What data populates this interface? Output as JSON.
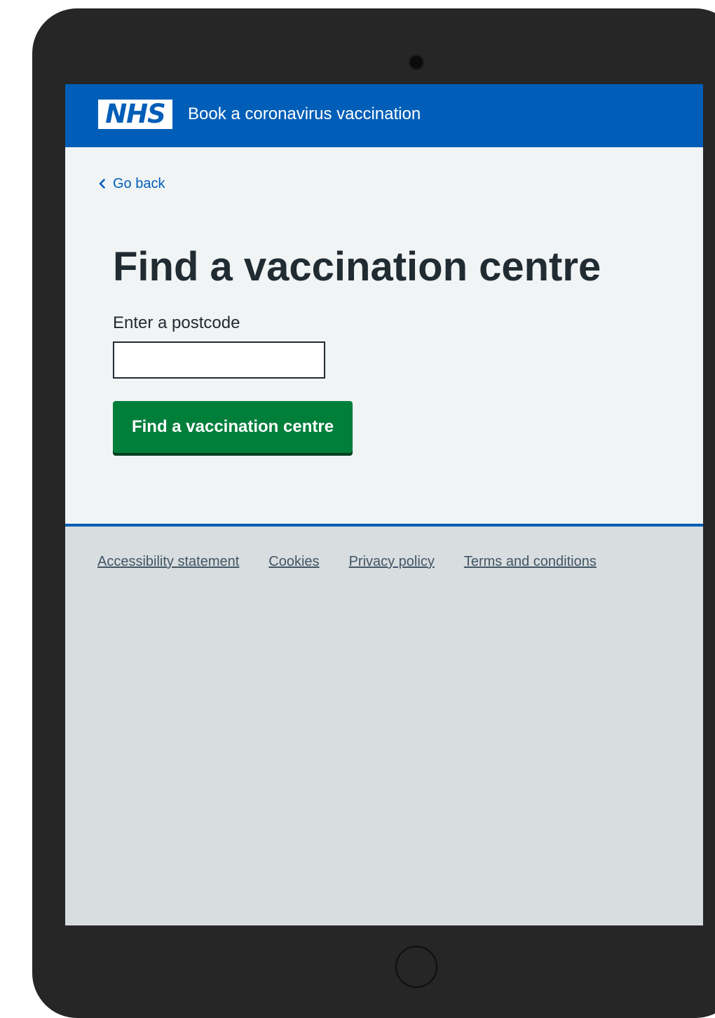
{
  "header": {
    "logo_text": "NHS",
    "service_name": "Book a coronavirus vaccination"
  },
  "nav": {
    "back_label": "Go back",
    "back_icon": "chevron-left-icon"
  },
  "main": {
    "title": "Find a vaccination centre",
    "postcode_label": "Enter a postcode",
    "postcode_value": "",
    "submit_label": "Find a vaccination centre"
  },
  "footer": {
    "links": [
      "Accessibility statement",
      "Cookies",
      "Privacy policy",
      "Terms and conditions"
    ]
  },
  "colors": {
    "nhs_blue": "#005eb8",
    "button_green": "#007f3b",
    "page_background": "#f0f4f5",
    "footer_background": "#d8dde0",
    "text": "#212b32",
    "device_frame": "#262626"
  }
}
